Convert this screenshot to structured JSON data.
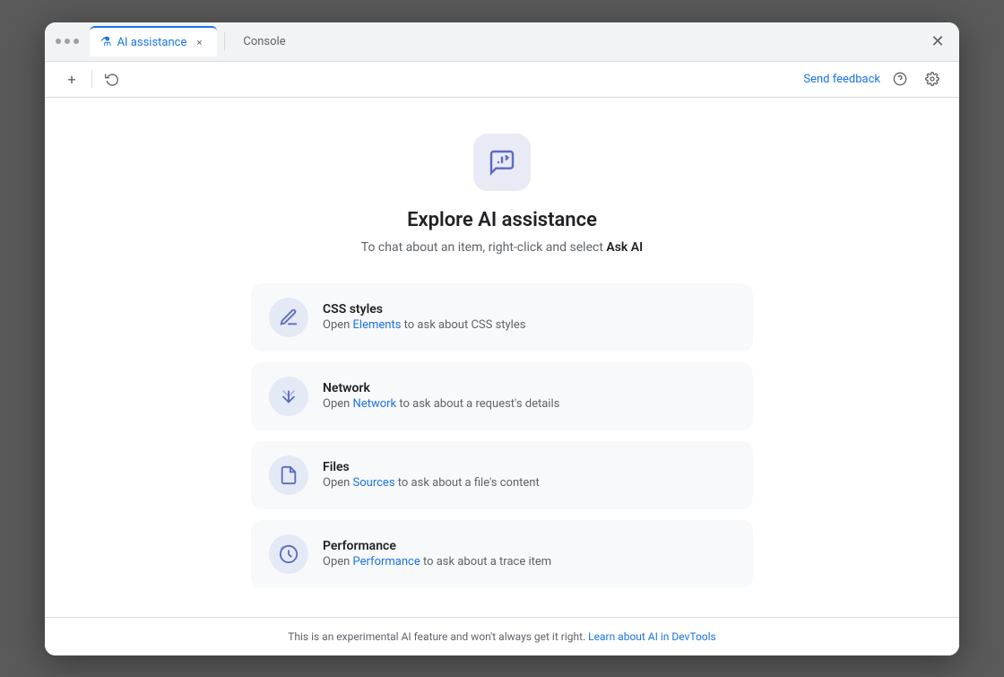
{
  "window": {
    "close_label": "✕"
  },
  "title_bar": {
    "dots": [
      "dot1",
      "dot2",
      "dot3"
    ],
    "tabs": [
      {
        "id": "ai-assistance",
        "label": "AI assistance",
        "active": true,
        "icon": "⚗",
        "close": "×"
      },
      {
        "id": "console",
        "label": "Console",
        "active": false
      }
    ],
    "window_close": "✕"
  },
  "toolbar": {
    "add_label": "+",
    "history_icon": "↺",
    "send_feedback": "Send feedback",
    "help_icon": "?",
    "settings_icon": "⚙"
  },
  "hero": {
    "title": "Explore AI assistance",
    "subtitle_text": "To chat about an item, right-click and select ",
    "subtitle_bold": "Ask AI"
  },
  "cards": [
    {
      "id": "css-styles",
      "title": "CSS styles",
      "desc_prefix": "Open ",
      "link_text": "Elements",
      "desc_suffix": " to ask about CSS styles",
      "icon": "css"
    },
    {
      "id": "network",
      "title": "Network",
      "desc_prefix": "Open ",
      "link_text": "Network",
      "desc_suffix": " to ask about a request's details",
      "icon": "network"
    },
    {
      "id": "files",
      "title": "Files",
      "desc_prefix": "Open ",
      "link_text": "Sources",
      "desc_suffix": " to ask about a file's content",
      "icon": "files"
    },
    {
      "id": "performance",
      "title": "Performance",
      "desc_prefix": "Open ",
      "link_text": "Performance",
      "desc_suffix": " to ask about a trace item",
      "icon": "performance"
    }
  ],
  "footer": {
    "text": "This is an experimental AI feature and won't always get it right. ",
    "link_text": "Learn about AI in DevTools"
  }
}
